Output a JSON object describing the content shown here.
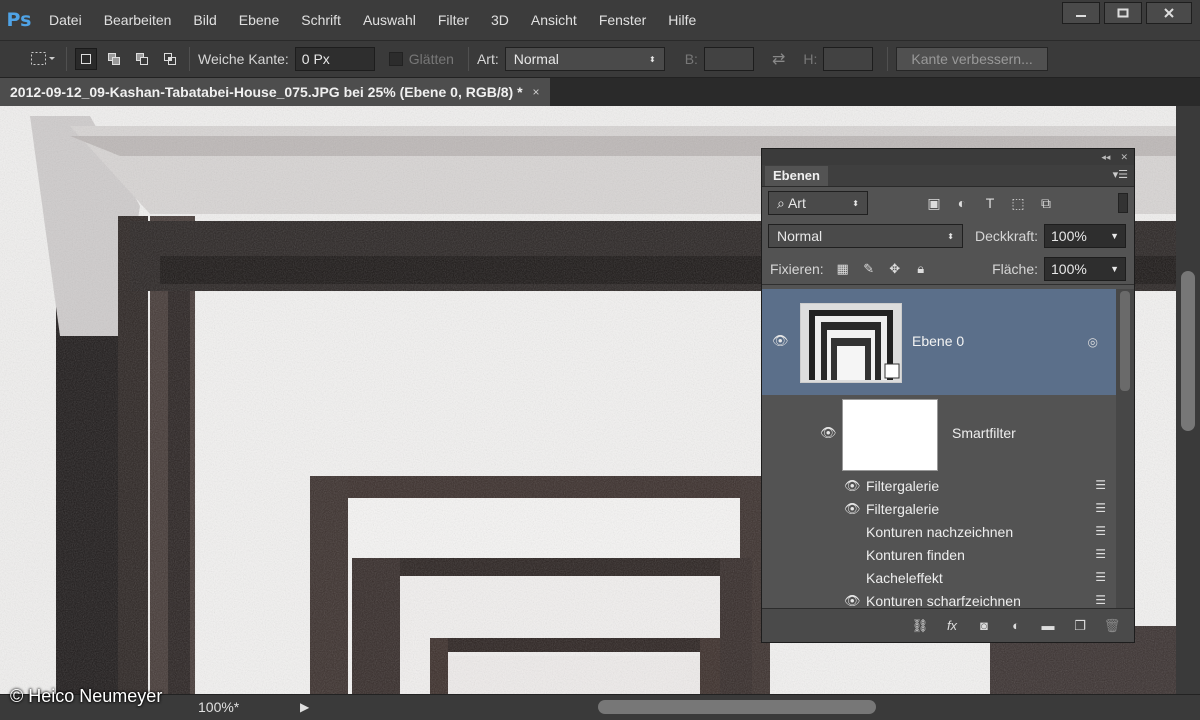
{
  "app": {
    "logo": "Ps",
    "menu": [
      "Datei",
      "Bearbeiten",
      "Bild",
      "Ebene",
      "Schrift",
      "Auswahl",
      "Filter",
      "3D",
      "Ansicht",
      "Fenster",
      "Hilfe"
    ]
  },
  "options": {
    "feather_label": "Weiche Kante:",
    "feather_value": "0 Px",
    "antialias_label": "Glätten",
    "style_label": "Art:",
    "style_value": "Normal",
    "width_label": "B:",
    "height_label": "H:",
    "refine_button": "Kante verbessern..."
  },
  "document": {
    "tab_title": "2012-09-12_09-Kashan-Tabatabei-House_075.JPG bei 25% (Ebene 0, RGB/8) *",
    "tab_close": "×"
  },
  "status": {
    "zoom": "100%*",
    "copyright": "© Heico Neumeyer"
  },
  "layers_panel": {
    "tab_label": "Ebenen",
    "filter_kind": "Art",
    "blend_mode": "Normal",
    "opacity_label": "Deckkraft:",
    "opacity_value": "100%",
    "lock_label": "Fixieren:",
    "fill_label": "Fläche:",
    "fill_value": "100%",
    "layer_name": "Ebene 0",
    "smartfilter_label": "Smartfilter",
    "filters": [
      {
        "name": "Filtergalerie",
        "visible": true
      },
      {
        "name": "Filtergalerie",
        "visible": true
      },
      {
        "name": "Konturen nachzeichnen",
        "visible": false
      },
      {
        "name": "Konturen finden",
        "visible": false
      },
      {
        "name": "Kacheleffekt",
        "visible": false
      },
      {
        "name": "Konturen scharfzeichnen",
        "visible": true
      }
    ]
  },
  "colors": {
    "selected_layer": "#5b6f8a",
    "panel_bg": "#535353",
    "ps_blue": "#4fa3e6"
  }
}
